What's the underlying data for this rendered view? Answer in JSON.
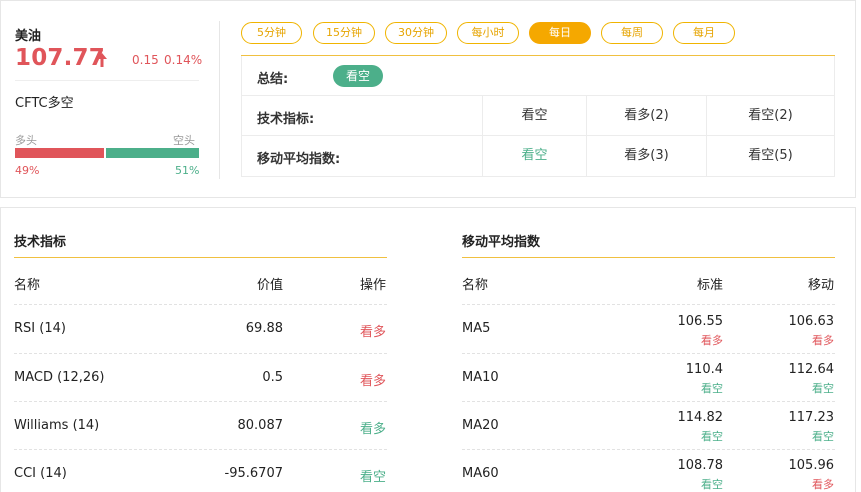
{
  "instrument": {
    "name": "美油",
    "price": "107.77",
    "change": "0.15",
    "change_pct": "0.14%",
    "cftc_label": "CFTC多空",
    "bull_label": "多头",
    "bear_label": "空头",
    "bull_pct": "49%",
    "bear_pct": "51%",
    "bull_ratio": 0.49
  },
  "timeframes": [
    {
      "label": "5分钟",
      "active": false
    },
    {
      "label": "15分钟",
      "active": false
    },
    {
      "label": "30分钟",
      "active": false
    },
    {
      "label": "每小时",
      "active": false
    },
    {
      "label": "每日",
      "active": true
    },
    {
      "label": "每周",
      "active": false
    },
    {
      "label": "每月",
      "active": false
    }
  ],
  "summary": {
    "overall_label": "总结:",
    "overall_value": "看空",
    "tech_label": "技术指标:",
    "tech_signal": "看空",
    "tech_buy": "看多(2)",
    "tech_sell": "看空(2)",
    "ma_label": "移动平均指数:",
    "ma_signal": "看空",
    "ma_buy": "看多(3)",
    "ma_sell": "看空(5)"
  },
  "tech_indicators": {
    "title": "技术指标",
    "headers": {
      "name": "名称",
      "value": "价值",
      "action": "操作"
    },
    "rows": [
      {
        "name": "RSI",
        "param": "(14)",
        "value": "69.88",
        "action": "看多",
        "bull": true
      },
      {
        "name": "MACD",
        "param": "(12,26)",
        "value": "0.5",
        "action": "看多",
        "bull": true
      },
      {
        "name": "Williams",
        "param": "(14)",
        "value": "80.087",
        "action": "看多",
        "bull": false
      },
      {
        "name": "CCI",
        "param": "(14)",
        "value": "-95.6707",
        "action": "看空",
        "bull": false
      }
    ]
  },
  "moving_averages": {
    "title": "移动平均指数",
    "headers": {
      "name": "名称",
      "standard": "标准",
      "moving": "移动"
    },
    "rows": [
      {
        "name": "MA5",
        "std_value": "106.55",
        "std_signal": "看多",
        "std_bull": true,
        "mov_value": "106.63",
        "mov_signal": "看多",
        "mov_bull": true
      },
      {
        "name": "MA10",
        "std_value": "110.4",
        "std_signal": "看空",
        "std_bull": false,
        "mov_value": "112.64",
        "mov_signal": "看空",
        "mov_bull": false
      },
      {
        "name": "MA20",
        "std_value": "114.82",
        "std_signal": "看空",
        "std_bull": false,
        "mov_value": "117.23",
        "mov_signal": "看空",
        "mov_bull": false
      },
      {
        "name": "MA60",
        "std_value": "108.78",
        "std_signal": "看空",
        "std_bull": false,
        "mov_value": "105.96",
        "mov_signal": "看多",
        "mov_bull": true
      }
    ]
  },
  "colors": {
    "bull": "#e0555a",
    "bear": "#4caf8a",
    "accent": "#f5a800"
  }
}
